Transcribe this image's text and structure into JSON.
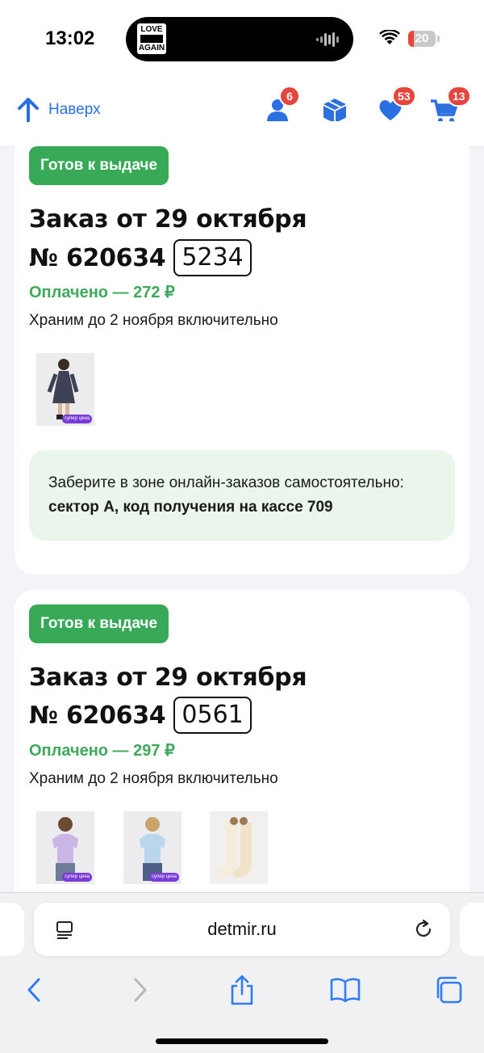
{
  "status_bar": {
    "time": "13:02",
    "island_art_top": "LOVE",
    "island_art_bottom": "AGAIN",
    "battery_percent": "20",
    "battery_level": 0.2,
    "battery_color": "#e5483a"
  },
  "header": {
    "back_to_top_label": "Наверх",
    "profile_badge": "6",
    "favorites_badge": "53",
    "cart_badge": "13",
    "accent_color": "#2c6fe0",
    "badge_color": "#e5453d"
  },
  "orders": [
    {
      "status": "Готов к выдаче",
      "title": "Заказ от 29 октября",
      "number": "№ 620634",
      "code": "5234",
      "paid": "Оплачено — 272 ₽",
      "storage": "Храним до 2 ноября включительно",
      "items": [
        {
          "icon": "dress-photo",
          "promo": "супер цена"
        }
      ],
      "pickup_prefix": "Заберите в зоне онлайн-заказов самостоятельно: ",
      "pickup_bold": "сектор А, код получения на кассе 709"
    },
    {
      "status": "Готов к выдаче",
      "title": "Заказ от 29 октября",
      "number": "№ 620634",
      "code": "0561",
      "paid": "Оплачено — 297 ₽",
      "storage": "Храним до 2 ноября включительно",
      "items": [
        {
          "icon": "lilac-tshirt-photo",
          "promo": "супер цена"
        },
        {
          "icon": "blue-tshirt-photo",
          "promo": "супер цена"
        },
        {
          "icon": "socks-photo",
          "promo": ""
        }
      ]
    }
  ],
  "browser": {
    "url": "detmir.ru"
  },
  "colors": {
    "status_green": "#37a957",
    "paid_green": "#3fa95b",
    "note_bg": "#eaf6ec",
    "page_bg": "#f2f4f8"
  }
}
